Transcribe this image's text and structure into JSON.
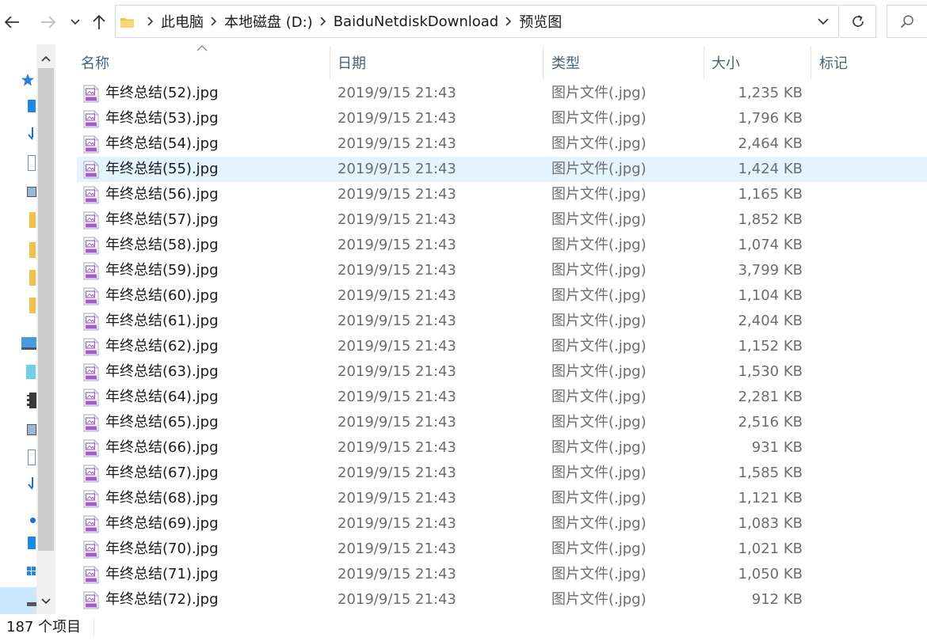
{
  "window": {
    "breadcrumbs": [
      "此电脑",
      "本地磁盘 (D:)",
      "BaiduNetdiskDownload",
      "预览图"
    ]
  },
  "columns": {
    "name": "名称",
    "date": "日期",
    "type": "类型",
    "size": "大小",
    "tags": "标记"
  },
  "files": [
    {
      "name": "年终总结(52).jpg",
      "date": "2019/9/15 21:43",
      "type": "图片文件(.jpg)",
      "size": "1,235 KB"
    },
    {
      "name": "年终总结(53).jpg",
      "date": "2019/9/15 21:43",
      "type": "图片文件(.jpg)",
      "size": "1,796 KB"
    },
    {
      "name": "年终总结(54).jpg",
      "date": "2019/9/15 21:43",
      "type": "图片文件(.jpg)",
      "size": "2,464 KB"
    },
    {
      "name": "年终总结(55).jpg",
      "date": "2019/9/15 21:43",
      "type": "图片文件(.jpg)",
      "size": "1,424 KB",
      "selected": true
    },
    {
      "name": "年终总结(56).jpg",
      "date": "2019/9/15 21:43",
      "type": "图片文件(.jpg)",
      "size": "1,165 KB"
    },
    {
      "name": "年终总结(57).jpg",
      "date": "2019/9/15 21:43",
      "type": "图片文件(.jpg)",
      "size": "1,852 KB"
    },
    {
      "name": "年终总结(58).jpg",
      "date": "2019/9/15 21:43",
      "type": "图片文件(.jpg)",
      "size": "1,074 KB"
    },
    {
      "name": "年终总结(59).jpg",
      "date": "2019/9/15 21:43",
      "type": "图片文件(.jpg)",
      "size": "3,799 KB"
    },
    {
      "name": "年终总结(60).jpg",
      "date": "2019/9/15 21:43",
      "type": "图片文件(.jpg)",
      "size": "1,104 KB"
    },
    {
      "name": "年终总结(61).jpg",
      "date": "2019/9/15 21:43",
      "type": "图片文件(.jpg)",
      "size": "2,404 KB"
    },
    {
      "name": "年终总结(62).jpg",
      "date": "2019/9/15 21:43",
      "type": "图片文件(.jpg)",
      "size": "1,152 KB"
    },
    {
      "name": "年终总结(63).jpg",
      "date": "2019/9/15 21:43",
      "type": "图片文件(.jpg)",
      "size": "1,530 KB"
    },
    {
      "name": "年终总结(64).jpg",
      "date": "2019/9/15 21:43",
      "type": "图片文件(.jpg)",
      "size": "2,281 KB"
    },
    {
      "name": "年终总结(65).jpg",
      "date": "2019/9/15 21:43",
      "type": "图片文件(.jpg)",
      "size": "2,516 KB"
    },
    {
      "name": "年终总结(66).jpg",
      "date": "2019/9/15 21:43",
      "type": "图片文件(.jpg)",
      "size": "931 KB"
    },
    {
      "name": "年终总结(67).jpg",
      "date": "2019/9/15 21:43",
      "type": "图片文件(.jpg)",
      "size": "1,585 KB"
    },
    {
      "name": "年终总结(68).jpg",
      "date": "2019/9/15 21:43",
      "type": "图片文件(.jpg)",
      "size": "1,121 KB"
    },
    {
      "name": "年终总结(69).jpg",
      "date": "2019/9/15 21:43",
      "type": "图片文件(.jpg)",
      "size": "1,083 KB"
    },
    {
      "name": "年终总结(70).jpg",
      "date": "2019/9/15 21:43",
      "type": "图片文件(.jpg)",
      "size": "1,021 KB"
    },
    {
      "name": "年终总结(71).jpg",
      "date": "2019/9/15 21:43",
      "type": "图片文件(.jpg)",
      "size": "1,050 KB"
    },
    {
      "name": "年终总结(72).jpg",
      "date": "2019/9/15 21:43",
      "type": "图片文件(.jpg)",
      "size": "912 KB"
    }
  ],
  "status": {
    "item_count": "187 个项目"
  },
  "icons": {
    "back": "arrow-left-icon",
    "forward": "arrow-right-icon",
    "recent": "chevron-down-icon",
    "up": "arrow-up-icon",
    "refresh": "refresh-icon",
    "search": "search-icon",
    "file": "jpg-file-icon",
    "folder": "folder-icon"
  },
  "colors": {
    "selected_row": "#e5f3ff",
    "header_text": "#4c607a",
    "file_icon_accent": "#a55dc6",
    "folder": "#f3c04b"
  }
}
